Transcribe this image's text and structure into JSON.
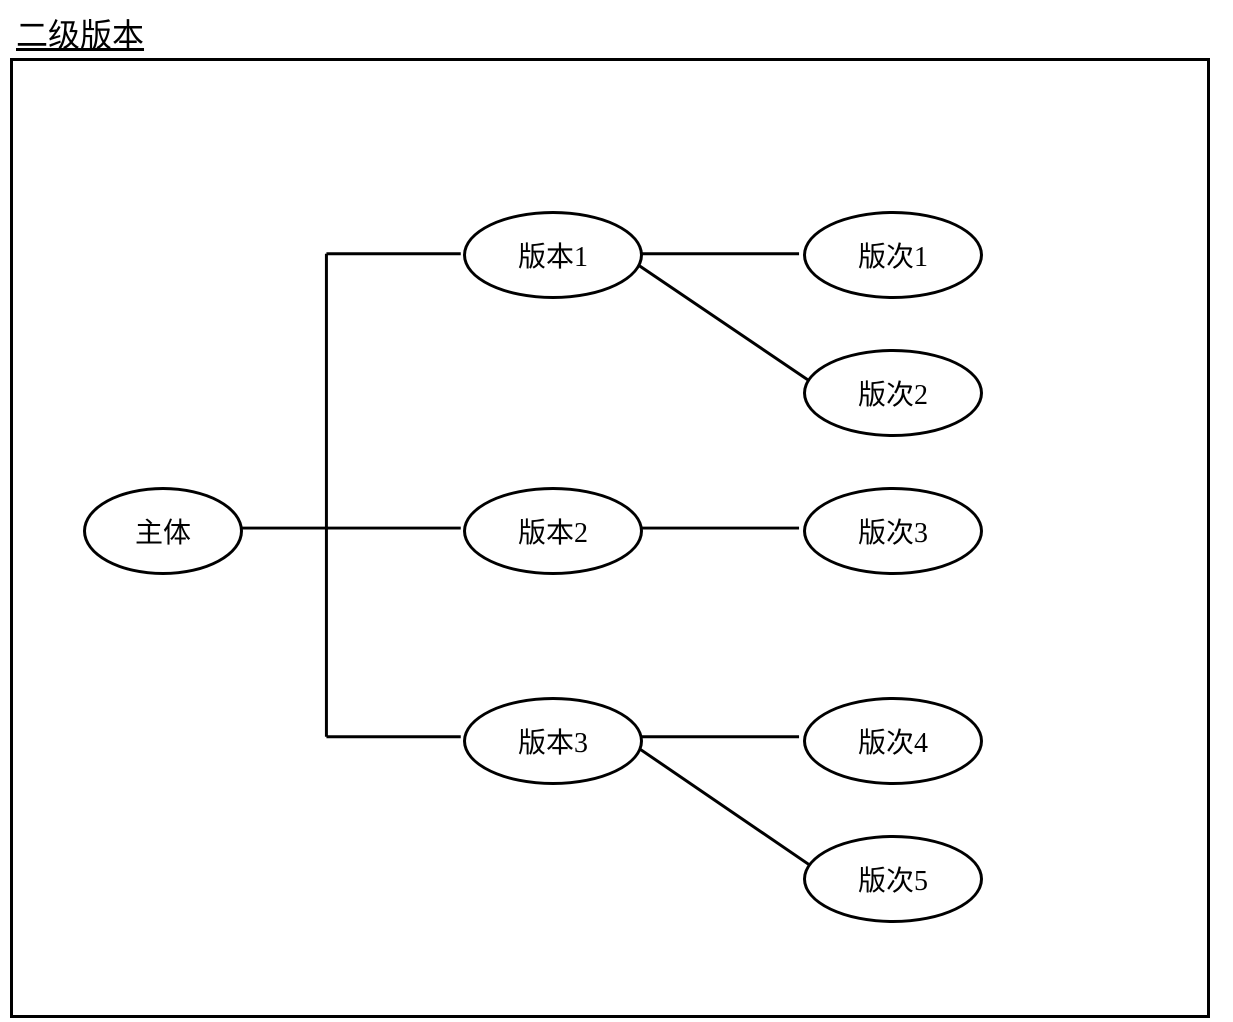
{
  "title": "二级版本",
  "nodes": {
    "root": "主体",
    "v1": "版本1",
    "v2": "版本2",
    "v3": "版本3",
    "r1": "版次1",
    "r2": "版次2",
    "r3": "版次3",
    "r4": "版次4",
    "r5": "版次5"
  }
}
